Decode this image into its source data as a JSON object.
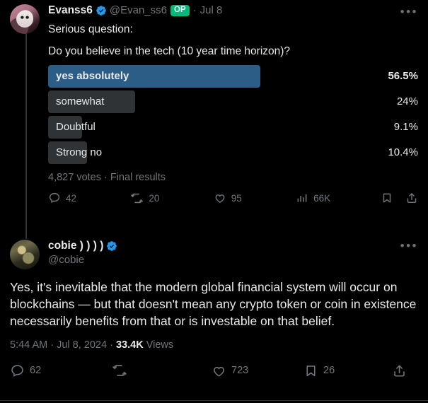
{
  "thread": {
    "tweets": [
      {
        "author": {
          "display_name": "Evanss6",
          "handle": "@Evan_ss6",
          "verified_icon": "verified-badge-icon",
          "op_badge": "OP",
          "avatar_icon": "avatar-image"
        },
        "separator": "·",
        "date": "Jul 8",
        "more_icon": "more-options-icon",
        "text": "Serious question:",
        "poll": {
          "question": "Do you believe in the tech (10 year time horizon)?",
          "options": [
            {
              "label": "yes absolutely",
              "percent": "56.5%",
              "value": 56.5,
              "winner": true
            },
            {
              "label": "somewhat",
              "percent": "24%",
              "value": 24,
              "winner": false
            },
            {
              "label": "Doubtful",
              "percent": "9.1%",
              "value": 9.1,
              "winner": false
            },
            {
              "label": "Strong no",
              "percent": "10.4%",
              "value": 10.4,
              "winner": false
            }
          ],
          "meta": "4,827 votes · Final results",
          "winner_color": "#2c5d87",
          "bar_color": "#2f3336"
        },
        "actions": {
          "reply": {
            "icon": "reply-icon",
            "count": "42"
          },
          "retweet": {
            "icon": "retweet-icon",
            "count": "20"
          },
          "like": {
            "icon": "heart-icon",
            "count": "95"
          },
          "views": {
            "icon": "analytics-icon",
            "count": "66K"
          },
          "bookmark": {
            "icon": "bookmark-icon",
            "count": ""
          },
          "share": {
            "icon": "share-icon",
            "count": ""
          }
        }
      },
      {
        "author": {
          "display_name": "cobie ) ) ) )",
          "handle": "@cobie",
          "verified_icon": "verified-badge-icon",
          "avatar_icon": "avatar-image"
        },
        "more_icon": "more-options-icon",
        "text": "Yes, it's inevitable that the modern global financial system will occur on blockchains — but that doesn't mean any crypto token or coin in existence necessarily benefits from that or is investable on that belief.",
        "timestamp": {
          "time": "5:44 AM",
          "sep1": "·",
          "date": "Jul 8, 2024",
          "sep2": "·",
          "views_count": "33.4K",
          "views_label": "Views"
        },
        "actions": {
          "reply": {
            "icon": "reply-icon",
            "count": "62"
          },
          "retweet": {
            "icon": "retweet-icon",
            "count": ""
          },
          "like": {
            "icon": "heart-icon",
            "count": "723"
          },
          "bookmark": {
            "icon": "bookmark-icon",
            "count": "26"
          },
          "share": {
            "icon": "share-icon",
            "count": ""
          }
        }
      }
    ]
  },
  "theme": {
    "background": "#000000",
    "text": "#e7e9ea",
    "muted": "#71767b",
    "verified_blue": "#1d9bf0",
    "op_green": "#00ba7c",
    "border": "#2f3336"
  }
}
